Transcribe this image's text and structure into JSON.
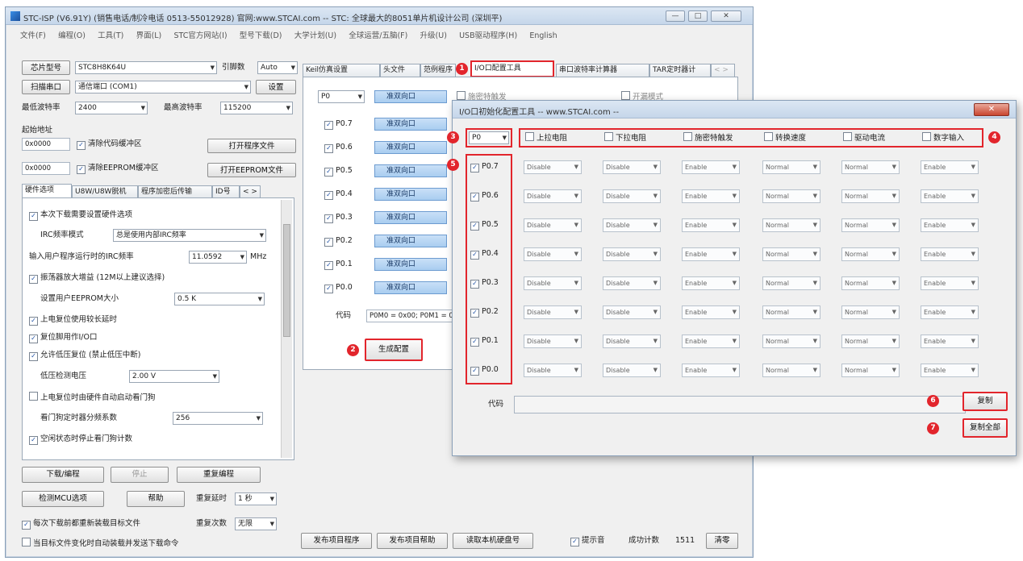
{
  "main_window": {
    "title": "STC-ISP (V6.91Y) (销售电话/制冷电话 0513-55012928) 官网:www.STCAI.com  -- STC: 全球最大的8051单片机设计公司 (深圳平)",
    "min_label": "—",
    "max_label": "□",
    "close_label": "✕",
    "menu": [
      "文件(F)",
      "编程(O)",
      "工具(T)",
      "界面(L)",
      "STC官方网站(I)",
      "型号下载(D)",
      "大学计划(U)",
      "全球运营/五脑(F)",
      "升级(U)",
      "USB驱动程序(H)",
      "English"
    ]
  },
  "left": {
    "mcu_type_btn": "芯片型号",
    "mcu_type_value": "STC8H8K64U",
    "pin_label": "引脚数",
    "pin_value": "Auto",
    "scan_port_btn": "扫描串口",
    "port_value": "通信端口 (COM1)",
    "settings_btn": "设置",
    "min_baud_label": "最低波特率",
    "min_baud_value": "2400",
    "max_baud_label": "最高波特率",
    "max_baud_value": "115200",
    "start_addr_label": "起始地址",
    "addr1": "0x0000",
    "clear_code_label": "清除代码缓冲区",
    "open_prog_btn": "打开程序文件",
    "addr2": "0x0000",
    "clear_eeprom_label": "清除EEPROM缓冲区",
    "open_eeprom_btn": "打开EEPROM文件",
    "tabs": [
      "硬件选项",
      "U8W/U8W脱机",
      "程序加密后传输",
      "ID号"
    ],
    "tab_more": "< >",
    "options": [
      {
        "text": "本次下载需要设置硬件选项",
        "checked": true
      },
      {
        "text": "IRC频率模式",
        "checked": null,
        "combo": "总是使用内部IRC频率"
      },
      {
        "text": "输入用户程序运行时的IRC频率",
        "checked": null,
        "combo": "11.0592",
        "unit": "MHz"
      },
      {
        "text": "振荡器放大增益 (12M以上建议选择)",
        "checked": true
      },
      {
        "text": "设置用户EEPROM大小",
        "checked": null,
        "combo": "0.5 K"
      },
      {
        "text": "上电复位使用较长延时",
        "checked": true
      },
      {
        "text": "复位脚用作I/O口",
        "checked": true
      },
      {
        "text": "允许低压复位 (禁止低压中断)",
        "checked": true
      },
      {
        "text": "低压检测电压",
        "checked": null,
        "combo": "2.00 V"
      },
      {
        "text": "上电复位时由硬件自动启动看门狗",
        "checked": false
      },
      {
        "text": "看门狗定时器分频系数",
        "checked": null,
        "combo": "256"
      },
      {
        "text": "空闲状态时停止看门狗计数",
        "checked": true
      }
    ],
    "download_btn": "下载/编程",
    "stop_btn": "停止",
    "reprog_btn": "重复编程",
    "check_mcu_btn": "检测MCU选项",
    "help_btn": "帮助",
    "repeat_delay_label": "重复延时",
    "repeat_delay_value": "1 秒",
    "repeat_count_label": "重复次数",
    "repeat_count_value": "无限",
    "reload_label": "每次下载前都重新装载目标文件",
    "auto_send_label": "当目标文件变化时自动装载并发送下载命令"
  },
  "right": {
    "tabs": [
      "Keil仿真设置",
      "头文件",
      "范例程序",
      "I/O口配置工具",
      "串口波特率计算器",
      "TAR定时器计"
    ],
    "port_select": "P0",
    "ports": [
      "P0.7",
      "P0.6",
      "P0.5",
      "P0.4",
      "P0.3",
      "P0.2",
      "P0.1",
      "P0.0"
    ],
    "mode_label": "准双向口",
    "col_hidden1": "施密特触发",
    "col_hidden2": "开漏模式",
    "code_label": "代码",
    "code_value": "P0M0 = 0x00; P0M1 = 0x00;",
    "gen_btn": "生成配置",
    "bottom_btns": [
      "发布项目程序",
      "发布项目帮助",
      "读取本机硬盘号"
    ],
    "beep_label": "提示音",
    "count_label": "成功计数",
    "count_value": "1511",
    "clear_btn": "清零",
    "markers": [
      "1",
      "2"
    ]
  },
  "dialog": {
    "title": "I/O口初始化配置工具 -- www.STCAI.com --",
    "close_label": "✕",
    "port_select": "P0",
    "headers": [
      "上拉电阻",
      "下拉电阻",
      "施密特触发",
      "转换速度",
      "驱动电流",
      "数字输入"
    ],
    "ports": [
      "P0.7",
      "P0.6",
      "P0.5",
      "P0.4",
      "P0.3",
      "P0.2",
      "P0.1",
      "P0.0"
    ],
    "rows": [
      [
        "Disable",
        "Disable",
        "Enable",
        "Normal",
        "Normal",
        "Enable"
      ],
      [
        "Disable",
        "Disable",
        "Enable",
        "Normal",
        "Normal",
        "Enable"
      ],
      [
        "Disable",
        "Disable",
        "Enable",
        "Normal",
        "Normal",
        "Enable"
      ],
      [
        "Disable",
        "Disable",
        "Enable",
        "Normal",
        "Normal",
        "Enable"
      ],
      [
        "Disable",
        "Disable",
        "Enable",
        "Normal",
        "Normal",
        "Enable"
      ],
      [
        "Disable",
        "Disable",
        "Enable",
        "Normal",
        "Normal",
        "Enable"
      ],
      [
        "Disable",
        "Disable",
        "Enable",
        "Normal",
        "Normal",
        "Enable"
      ],
      [
        "Disable",
        "Disable",
        "Enable",
        "Normal",
        "Normal",
        "Enable"
      ]
    ],
    "code_label": "代码",
    "code_value": "",
    "copy_btn": "复制",
    "copy_all_btn": "复制全部",
    "markers": [
      "3",
      "4",
      "5",
      "6",
      "7"
    ]
  },
  "colors": {
    "highlight": "#e2252c",
    "port_blue": "#a9cdf0"
  }
}
